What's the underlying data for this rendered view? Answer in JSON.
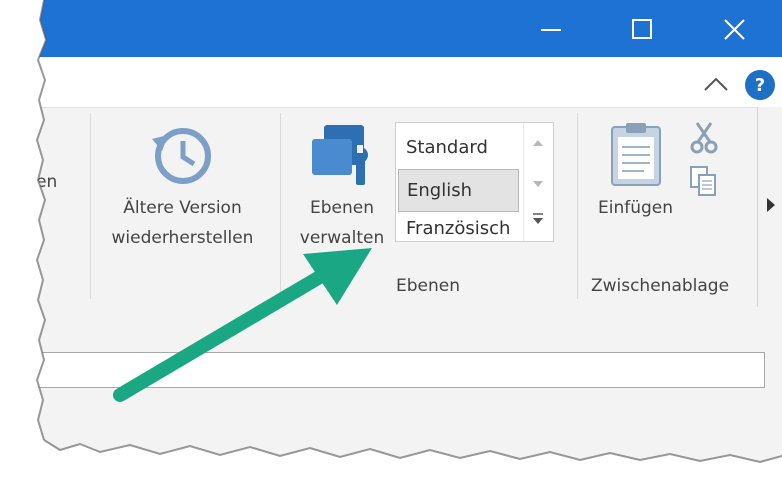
{
  "window": {
    "minimize_icon": "minimize-icon",
    "maximize_icon": "maximize-icon",
    "close_icon": "close-icon",
    "accent_color": "#1d72d4"
  },
  "subbar": {
    "collapse_icon": "chevron-up-icon",
    "help_label": "?"
  },
  "ribbon": {
    "partial_left_label": "en",
    "restore": {
      "icon": "history-clock-icon",
      "line1": "Ältere Version",
      "line2": "wiederherstellen"
    },
    "layers": {
      "icon": "layers-manage-icon",
      "line1": "Ebenen",
      "line2": "verwalten",
      "group_label": "Ebenen",
      "list_items": [
        "Standard",
        "English",
        "Französisch"
      ],
      "selected_item": "English"
    },
    "clipboard": {
      "paste_label": "Einfügen",
      "group_label": "Zwischenablage",
      "cut_icon": "scissors-icon",
      "copy_icon": "copy-icon",
      "paste_icon": "clipboard-icon"
    }
  },
  "annotation": {
    "arrow_color": "#1aa884"
  }
}
